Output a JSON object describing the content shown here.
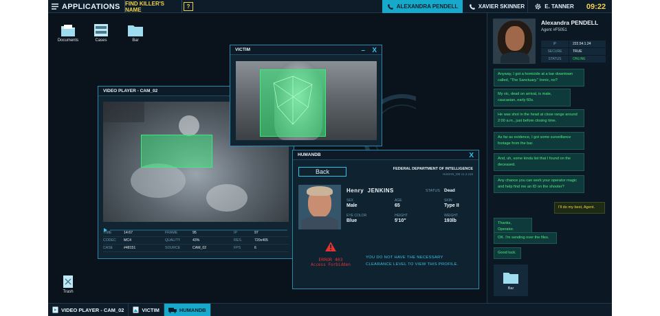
{
  "topbar": {
    "apps_label": "Applications",
    "task_label": "Find killer's name",
    "help_label": "?",
    "tabs": [
      "Alexandra Pendell",
      "Xavier Skinner",
      "E. Tanner"
    ],
    "clock": "09:22"
  },
  "desktop": {
    "icons": [
      "Documents",
      "Cases",
      "Bar"
    ],
    "trash": "Trash"
  },
  "video_player": {
    "title": "VIDEO PLAYER - CAM_02",
    "progress": 0.0,
    "stats": [
      [
        "TIME",
        "14:67",
        "FRAME",
        "95",
        "IP",
        "97"
      ],
      [
        "CODEC",
        "MC4",
        "QUALITY",
        "43%",
        "RES.",
        "720x405"
      ],
      [
        "CASE",
        "#48151",
        "SOURCE",
        "CAM_02",
        "FPS",
        "6"
      ]
    ]
  },
  "victim": {
    "title": "VICTIM",
    "minimize": "–",
    "close": "X"
  },
  "humandb": {
    "title": "HUMANDB",
    "close": "X",
    "back": "Back",
    "department": "FEDERAL DEPARTMENT OF INTELLIGENCE",
    "version": "HUMAN_DB   v1.2.116",
    "first_name": "Henry",
    "last_name": "JENKINS",
    "status_label": "STATUS",
    "status_value": "Dead",
    "fields": {
      "sex_label": "SEX",
      "sex": "Male",
      "age_label": "AGE",
      "age": "65",
      "skin_label": "SKIN",
      "skin": "Type II",
      "eye_label": "EYE COLOR",
      "eye": "Blue",
      "height_label": "HEIGHT",
      "height": "5'10\"",
      "weight_label": "WEIGHT",
      "weight": "193lb"
    },
    "error_code": "ERROR 403",
    "error_msg": "Access Forbidden",
    "clearance": "YOU DO NOT HAVE THE NECESSARY CLEARANCE LEVEL TO VIEW THIS PROFILE."
  },
  "agent": {
    "name": "Alexandra PENDELL",
    "id": "Agent #F5051",
    "ip_label": "IP",
    "ip": "222.54.1.24",
    "secure_label": "SECURE",
    "secure": "TRUE",
    "status_label": "STATUS",
    "status": "ONLINE"
  },
  "chat": [
    "Anyway, I got a homicide at a bar downtown called, \"The Sanctuary.\" Ironic, no?",
    "My vic, dead on arrival, is male, caucasian, early 60s.",
    "He was shot in the head at close range around 2:00 a.m., just before closing time.",
    "As far as evidence, I got some surveillance footage from the bar.",
    "And, uh, some kinda list that I found on the deceased.",
    "Any chance you can work your operator magic and help find me an ID on the shooter?",
    "I'll do my best, Agent.",
    "Thanks, Operator.",
    "OK. I'm sending over the files.",
    "Good luck."
  ],
  "shared_file": "Bar",
  "taskbar": [
    "VIDEO PLAYER - CAM_02",
    "VICTIM",
    "HUMANDB"
  ],
  "colors": {
    "accent": "#17a9cc",
    "warning": "#f2d24a",
    "error": "#e23333",
    "chat_green": "#4ef07a",
    "background": "#0a121b"
  }
}
